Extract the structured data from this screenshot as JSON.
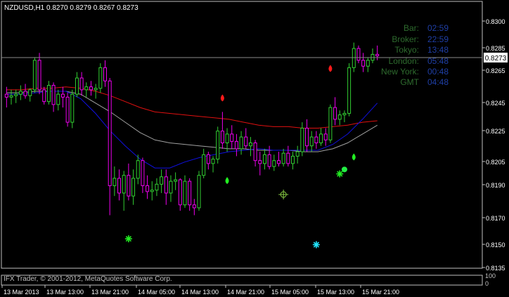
{
  "header": {
    "symbol_line": "NZDUSD,H1  0.8270 0.8279 0.8267 0.8273"
  },
  "info_panel": {
    "labels": [
      "Bar:",
      "Broker:",
      "Tokyo:",
      "London:",
      "New York:",
      "GMT"
    ],
    "values": [
      "02:59",
      "22:59",
      "13:48",
      "05:48",
      "00:48",
      "04:48"
    ],
    "label_color": "#2e6b2e",
    "value_color": "#1f3fa6"
  },
  "copyright": "IFX Trader, © 2001-2012, MetaQuotes Software Corp.",
  "price_axis": {
    "labels": [
      "0.8300",
      "0.8285",
      "0.8265",
      "0.8245",
      "0.8225",
      "0.8205",
      "0.8190",
      "0.8170",
      "0.8150",
      "0.8135"
    ],
    "current_price": "0.8273"
  },
  "time_axis": {
    "labels": [
      "13 Mar 2013",
      "13 Mar 13:00",
      "13 Mar 21:00",
      "14 Mar 05:00",
      "14 Mar 13:00",
      "14 Mar 21:00",
      "15 Mar 05:00",
      "15 Mar 13:00",
      "15 Mar 21:00"
    ]
  },
  "indicator_axis": {
    "top": "100",
    "bottom": "0"
  },
  "colors": {
    "background": "#000000",
    "axis": "#c0c0c0",
    "bull_candle": "#32cd32",
    "bear_candle": "#ee00ee",
    "ma_red": "#e01010",
    "ma_gray": "#a0a0a0",
    "ma_blue": "#1010e0"
  },
  "chart_data": {
    "type": "candlestick",
    "symbol": "NZDUSD",
    "timeframe": "H1",
    "ylim": [
      0.813,
      0.8308
    ],
    "yticks": [
      0.83,
      0.8285,
      0.8265,
      0.8245,
      0.8225,
      0.8205,
      0.819,
      0.817,
      0.815,
      0.8135
    ],
    "current_price": 0.8273,
    "candles": [
      [
        0.8247,
        0.8252,
        0.8238,
        0.8245
      ],
      [
        0.8245,
        0.825,
        0.824,
        0.8246
      ],
      [
        0.8246,
        0.825,
        0.8241,
        0.8247
      ],
      [
        0.8247,
        0.8253,
        0.8243,
        0.8249
      ],
      [
        0.8249,
        0.8254,
        0.8244,
        0.8246
      ],
      [
        0.8246,
        0.8251,
        0.8242,
        0.825
      ],
      [
        0.825,
        0.8272,
        0.8248,
        0.827
      ],
      [
        0.827,
        0.8275,
        0.8247,
        0.825
      ],
      [
        0.825,
        0.8252,
        0.824,
        0.8242
      ],
      [
        0.8242,
        0.8256,
        0.824,
        0.8253
      ],
      [
        0.8253,
        0.8255,
        0.8235,
        0.824
      ],
      [
        0.824,
        0.825,
        0.8236,
        0.8247
      ],
      [
        0.8247,
        0.8252,
        0.8238,
        0.8245
      ],
      [
        0.8245,
        0.8248,
        0.8225,
        0.8228
      ],
      [
        0.8228,
        0.825,
        0.8224,
        0.8247
      ],
      [
        0.8247,
        0.8262,
        0.8245,
        0.8258
      ],
      [
        0.8258,
        0.8262,
        0.8246,
        0.825
      ],
      [
        0.825,
        0.8255,
        0.8245,
        0.8252
      ],
      [
        0.8252,
        0.8256,
        0.8246,
        0.825
      ],
      [
        0.825,
        0.8254,
        0.8244,
        0.8251
      ],
      [
        0.8251,
        0.8268,
        0.8248,
        0.8265
      ],
      [
        0.8265,
        0.827,
        0.8252,
        0.8256
      ],
      [
        0.8256,
        0.8258,
        0.8165,
        0.8185
      ],
      [
        0.8185,
        0.8198,
        0.8178,
        0.819
      ],
      [
        0.819,
        0.8196,
        0.8175,
        0.818
      ],
      [
        0.818,
        0.8195,
        0.8168,
        0.8192
      ],
      [
        0.8192,
        0.82,
        0.8175,
        0.8178
      ],
      [
        0.8178,
        0.8196,
        0.8172,
        0.819
      ],
      [
        0.819,
        0.8206,
        0.8186,
        0.8202
      ],
      [
        0.8202,
        0.8204,
        0.818,
        0.8185
      ],
      [
        0.8185,
        0.8192,
        0.8176,
        0.8181
      ],
      [
        0.8181,
        0.8188,
        0.8175,
        0.8182
      ],
      [
        0.8182,
        0.819,
        0.8178,
        0.8186
      ],
      [
        0.8186,
        0.8196,
        0.818,
        0.8191
      ],
      [
        0.8191,
        0.8196,
        0.8172,
        0.818
      ],
      [
        0.818,
        0.8192,
        0.8174,
        0.8188
      ],
      [
        0.8188,
        0.8194,
        0.8182,
        0.8189
      ],
      [
        0.8189,
        0.819,
        0.8168,
        0.8172
      ],
      [
        0.8172,
        0.8192,
        0.817,
        0.8188
      ],
      [
        0.8188,
        0.819,
        0.8168,
        0.8172
      ],
      [
        0.8172,
        0.8176,
        0.8165,
        0.817
      ],
      [
        0.817,
        0.8195,
        0.8168,
        0.8192
      ],
      [
        0.8192,
        0.821,
        0.819,
        0.8206
      ],
      [
        0.8206,
        0.8208,
        0.8196,
        0.82
      ],
      [
        0.82,
        0.8205,
        0.8194,
        0.8203
      ],
      [
        0.8203,
        0.8225,
        0.82,
        0.8222
      ],
      [
        0.8222,
        0.8235,
        0.821,
        0.8214
      ],
      [
        0.8214,
        0.8224,
        0.8208,
        0.822
      ],
      [
        0.822,
        0.8226,
        0.821,
        0.8215
      ],
      [
        0.8215,
        0.822,
        0.8205,
        0.821
      ],
      [
        0.821,
        0.8222,
        0.8206,
        0.8218
      ],
      [
        0.8218,
        0.8224,
        0.821,
        0.8212
      ],
      [
        0.8212,
        0.8218,
        0.8205,
        0.8214
      ],
      [
        0.8214,
        0.8216,
        0.8198,
        0.8202
      ],
      [
        0.8202,
        0.8208,
        0.8192,
        0.82
      ],
      [
        0.82,
        0.821,
        0.8196,
        0.8206
      ],
      [
        0.8206,
        0.8212,
        0.8196,
        0.8198
      ],
      [
        0.8198,
        0.8206,
        0.8195,
        0.8202
      ],
      [
        0.8202,
        0.8208,
        0.8198,
        0.82
      ],
      [
        0.82,
        0.821,
        0.8198,
        0.8207
      ],
      [
        0.8207,
        0.8212,
        0.8198,
        0.82
      ],
      [
        0.82,
        0.8208,
        0.8196,
        0.8205
      ],
      [
        0.8205,
        0.8212,
        0.82,
        0.8208
      ],
      [
        0.8208,
        0.8228,
        0.8205,
        0.8224
      ],
      [
        0.8224,
        0.823,
        0.8208,
        0.8212
      ],
      [
        0.8212,
        0.8222,
        0.8208,
        0.8218
      ],
      [
        0.8218,
        0.8222,
        0.821,
        0.8214
      ],
      [
        0.8214,
        0.8224,
        0.8212,
        0.822
      ],
      [
        0.822,
        0.8224,
        0.8212,
        0.8216
      ],
      [
        0.8216,
        0.824,
        0.8214,
        0.8238
      ],
      [
        0.8238,
        0.8245,
        0.8226,
        0.823
      ],
      [
        0.823,
        0.8236,
        0.8226,
        0.8233
      ],
      [
        0.8233,
        0.8236,
        0.8228,
        0.8234
      ],
      [
        0.8234,
        0.8268,
        0.8232,
        0.8265
      ],
      [
        0.8265,
        0.8282,
        0.8262,
        0.8278
      ],
      [
        0.8278,
        0.828,
        0.8268,
        0.827
      ],
      [
        0.827,
        0.8275,
        0.8262,
        0.8266
      ],
      [
        0.8266,
        0.8272,
        0.8262,
        0.827
      ],
      [
        0.827,
        0.8278,
        0.8268,
        0.8274
      ],
      [
        0.8274,
        0.828,
        0.827,
        0.8273
      ]
    ],
    "moving_averages": [
      {
        "color": "red",
        "values": [
          0.825,
          0.825,
          0.8251,
          0.8251,
          0.8252,
          0.8251,
          0.8249,
          0.8246,
          0.8242,
          0.8238,
          0.8235,
          0.8234,
          0.8233,
          0.8232,
          0.8231,
          0.823,
          0.8228,
          0.8226,
          0.8225,
          0.8225,
          0.8224,
          0.8224,
          0.8225,
          0.8226,
          0.8228,
          0.8229
        ]
      },
      {
        "color": "gray",
        "values": [
          0.8248,
          0.8248,
          0.8249,
          0.8249,
          0.8249,
          0.8247,
          0.8241,
          0.8235,
          0.8228,
          0.8221,
          0.8216,
          0.8214,
          0.8213,
          0.8212,
          0.8211,
          0.821,
          0.821,
          0.8209,
          0.8209,
          0.8209,
          0.8208,
          0.8208,
          0.821,
          0.8214,
          0.822,
          0.8226
        ]
      },
      {
        "color": "blue",
        "values": [
          0.8247,
          0.8247,
          0.8248,
          0.8249,
          0.8249,
          0.8244,
          0.8234,
          0.8222,
          0.8212,
          0.8203,
          0.8197,
          0.8197,
          0.8201,
          0.8204,
          0.8206,
          0.8208,
          0.8209,
          0.821,
          0.8209,
          0.8209,
          0.8209,
          0.8209,
          0.8213,
          0.822,
          0.823,
          0.8241
        ]
      }
    ],
    "signals": [
      {
        "type": "red-drop",
        "bar": 46,
        "price": 0.8244
      },
      {
        "type": "red-drop",
        "bar": 69,
        "price": 0.8264
      },
      {
        "type": "green-drop",
        "bar": 47,
        "price": 0.8188
      },
      {
        "type": "green-drop",
        "bar": 74,
        "price": 0.8204
      },
      {
        "type": "green-dot",
        "bar": 72,
        "price": 0.8196
      },
      {
        "type": "green-star",
        "bar": 71,
        "price": 0.8193
      },
      {
        "type": "green-star",
        "bar": 26,
        "price": 0.8149
      },
      {
        "type": "cyan-star",
        "bar": 66,
        "price": 0.8145
      },
      {
        "type": "target",
        "bar": 59,
        "price": 0.8179
      }
    ]
  }
}
